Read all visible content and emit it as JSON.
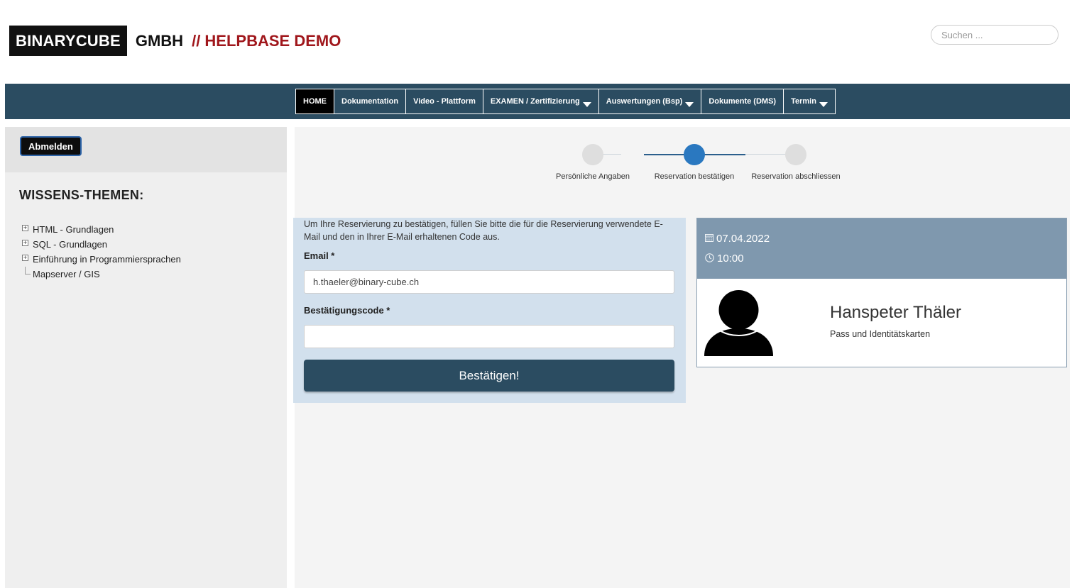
{
  "header": {
    "logo_box": "BINARYCUBE",
    "logo_gmbh": "GMBH",
    "logo_helpbase": "// HELPBASE DEMO",
    "search_placeholder": "Suchen ..."
  },
  "nav": {
    "items": [
      {
        "label": "HOME",
        "active": true,
        "dropdown": false
      },
      {
        "label": "Dokumentation",
        "active": false,
        "dropdown": false
      },
      {
        "label": "Video - Plattform",
        "active": false,
        "dropdown": false
      },
      {
        "label": "EXAMEN / Zertifizierung",
        "active": false,
        "dropdown": true
      },
      {
        "label": "Auswertungen (Bsp)",
        "active": false,
        "dropdown": true
      },
      {
        "label": "Dokumente (DMS)",
        "active": false,
        "dropdown": false
      },
      {
        "label": "Termin",
        "active": false,
        "dropdown": true
      }
    ]
  },
  "sidebar": {
    "logout_label": "Abmelden",
    "topics_title": "WISSENS-THEMEN:",
    "tree": [
      {
        "label": "HTML - Grundlagen",
        "expandable": true
      },
      {
        "label": "SQL - Grundlagen",
        "expandable": true
      },
      {
        "label": "Einführung in Programmiersprachen",
        "expandable": true
      },
      {
        "label": "Mapserver / GIS",
        "expandable": false
      }
    ]
  },
  "steps": [
    {
      "label": "Persönliche Angaben",
      "active": false
    },
    {
      "label": "Reservation bestätigen",
      "active": true
    },
    {
      "label": "Reservation abschliessen",
      "active": false
    }
  ],
  "form": {
    "intro": "Um Ihre Reservierung zu bestätigen, füllen Sie bitte die für die Reservierung verwendete E-Mail und den in Ihrer E-Mail erhaltenen Code aus.",
    "email_label": "Email *",
    "email_value": "h.thaeler@binary-cube.ch",
    "code_label": "Bestätigungscode *",
    "code_value": "",
    "submit_label": "Bestätigen!"
  },
  "appointment": {
    "date": "07.04.2022",
    "time": "10:00",
    "person_name": "Hanspeter Thäler",
    "person_subtitle": "Pass und Identitätskarten"
  },
  "colors": {
    "navbar": "#2b4c61",
    "brand_red": "#a0171c",
    "step_active": "#2a78c0",
    "form_panel": "#d2e0ed",
    "appt_header": "#7f98ae"
  },
  "icons": {
    "date": "calendar-icon",
    "time": "clock-icon",
    "avatar": "user-silhouette-icon"
  }
}
